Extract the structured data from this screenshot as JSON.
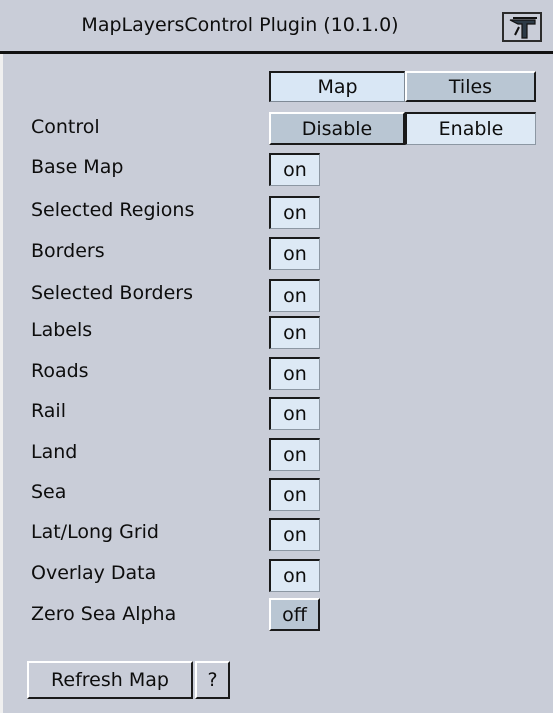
{
  "window": {
    "title": "MapLayersControl Plugin (10.1.0)",
    "logo_icon": "plugin-logo-icon"
  },
  "tabs": {
    "map_label": "Map",
    "tiles_label": "Tiles",
    "selected": "Map"
  },
  "control": {
    "label": "Control",
    "disable_label": "Disable",
    "enable_label": "Enable",
    "selected": "Enable"
  },
  "layers": [
    {
      "label": "Base Map",
      "state": "on"
    },
    {
      "label": "Selected Regions",
      "state": "on"
    },
    {
      "label": "Borders",
      "state": "on"
    },
    {
      "label": "Selected Borders",
      "state": "on"
    },
    {
      "label": "Labels",
      "state": "on"
    },
    {
      "label": "Roads",
      "state": "on"
    },
    {
      "label": "Rail",
      "state": "on"
    },
    {
      "label": "Land",
      "state": "on"
    },
    {
      "label": "Sea",
      "state": "on"
    },
    {
      "label": "Lat/Long Grid",
      "state": "on"
    },
    {
      "label": "Overlay Data",
      "state": "on"
    },
    {
      "label": "Zero Sea Alpha",
      "state": "off"
    }
  ],
  "footer": {
    "refresh_label": "Refresh Map",
    "help_label": "?"
  },
  "colors": {
    "panel_bg": "#c9cdd8",
    "button_pressed": "#dde9f5",
    "button_raised": "#b9c6d3"
  }
}
